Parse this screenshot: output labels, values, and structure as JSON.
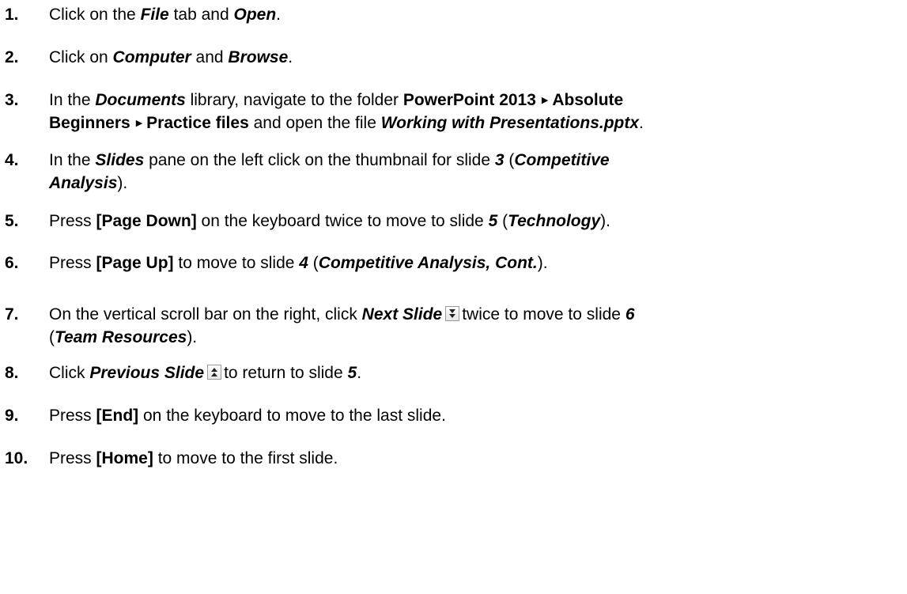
{
  "steps": [
    {
      "num": "1.",
      "parts": [
        {
          "t": "Click on the "
        },
        {
          "t": "File",
          "s": "bi"
        },
        {
          "t": " tab and "
        },
        {
          "t": "Open",
          "s": "bi"
        },
        {
          "t": "."
        }
      ]
    },
    {
      "num": "2.",
      "parts": [
        {
          "t": "Click on "
        },
        {
          "t": "Computer",
          "s": "bi"
        },
        {
          "t": " and "
        },
        {
          "t": "Browse",
          "s": "bi"
        },
        {
          "t": "."
        }
      ]
    },
    {
      "num": "3.",
      "lines": [
        [
          {
            "t": "In the "
          },
          {
            "t": "Documents",
            "s": "bi"
          },
          {
            "t": " library, navigate to the folder "
          },
          {
            "t": "PowerPoint 2013",
            "s": "b"
          },
          {
            "t": "▶",
            "s": "tri"
          },
          {
            "t": "Absolute",
            "s": "b"
          }
        ],
        [
          {
            "t": "Beginners",
            "s": "b"
          },
          {
            "t": "▶",
            "s": "tri"
          },
          {
            "t": "Practice files",
            "s": "b"
          },
          {
            "t": " and open the file "
          },
          {
            "t": "Working with Presentations.pptx",
            "s": "bi"
          },
          {
            "t": "."
          }
        ]
      ]
    },
    {
      "num": "4.",
      "lines": [
        [
          {
            "t": "In the "
          },
          {
            "t": "Slides",
            "s": "bi"
          },
          {
            "t": " pane on the left click on the thumbnail for slide "
          },
          {
            "t": "3",
            "s": "bi"
          },
          {
            "t": " ("
          },
          {
            "t": "Competitive",
            "s": "bi"
          }
        ],
        [
          {
            "t": "Analysis",
            "s": "bi"
          },
          {
            "t": ")."
          }
        ]
      ]
    },
    {
      "num": "5.",
      "parts": [
        {
          "t": "Press "
        },
        {
          "t": "[Page Down]",
          "s": "b"
        },
        {
          "t": " on the keyboard twice to move to slide "
        },
        {
          "t": "5",
          "s": "bi"
        },
        {
          "t": " ("
        },
        {
          "t": "Technology",
          "s": "bi"
        },
        {
          "t": ")."
        }
      ]
    },
    {
      "num": "6.",
      "parts": [
        {
          "t": "Press "
        },
        {
          "t": "[Page Up]",
          "s": "b"
        },
        {
          "t": " to move to slide "
        },
        {
          "t": "4",
          "s": "bi"
        },
        {
          "t": " ("
        },
        {
          "t": "Competitive Analysis, Cont.",
          "s": "bi"
        },
        {
          "t": ")."
        }
      ]
    },
    {
      "num": "7.",
      "lines": [
        [
          {
            "t": "On the vertical scroll bar on the right, click "
          },
          {
            "t": "Next Slide",
            "s": "bi"
          },
          {
            "icon": "next-slide-icon"
          },
          {
            "t": "twice to move to slide "
          },
          {
            "t": "6",
            "s": "bi"
          }
        ],
        [
          {
            "t": "("
          },
          {
            "t": "Team Resources",
            "s": "bi"
          },
          {
            "t": ")."
          }
        ]
      ]
    },
    {
      "num": "8.",
      "parts": [
        {
          "t": "Click "
        },
        {
          "t": "Previous Slide",
          "s": "bi"
        },
        {
          "icon": "previous-slide-icon"
        },
        {
          "t": "to return to slide "
        },
        {
          "t": "5",
          "s": "bi"
        },
        {
          "t": "."
        }
      ]
    },
    {
      "num": "9.",
      "parts": [
        {
          "t": "Press "
        },
        {
          "t": "[End]",
          "s": "b"
        },
        {
          "t": " on the keyboard to move to the last slide."
        }
      ]
    },
    {
      "num": "10.",
      "parts": [
        {
          "t": "Press "
        },
        {
          "t": "[Home]",
          "s": "b"
        },
        {
          "t": " to move to the first slide."
        }
      ]
    }
  ]
}
